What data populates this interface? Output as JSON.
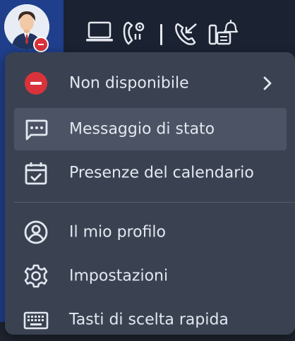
{
  "colors": {
    "accent_blue": "#1f3f8c",
    "status_red": "#d9323a",
    "menu_bg": "#3a4252",
    "text": "#e3e7ef"
  },
  "toolbar": {
    "icons": [
      "computer-icon",
      "phone-settings-icon",
      "separator",
      "call-forward-icon",
      "fax-alarm-icon"
    ]
  },
  "user": {
    "status": "unavailable"
  },
  "menu": {
    "status_item": {
      "label": "Non disponibile",
      "icon": "status-red-dot-icon",
      "has_submenu": true
    },
    "items": [
      {
        "label": "Messaggio di stato",
        "icon": "chat-bubble-icon"
      },
      {
        "label": "Presenze del calendario",
        "icon": "calendar-check-icon"
      },
      {
        "label": "Il mio profilo",
        "icon": "user-circle-icon"
      },
      {
        "label": "Impostazioni",
        "icon": "gear-icon"
      },
      {
        "label": "Tasti di scelta rapida",
        "icon": "keyboard-icon"
      }
    ]
  }
}
